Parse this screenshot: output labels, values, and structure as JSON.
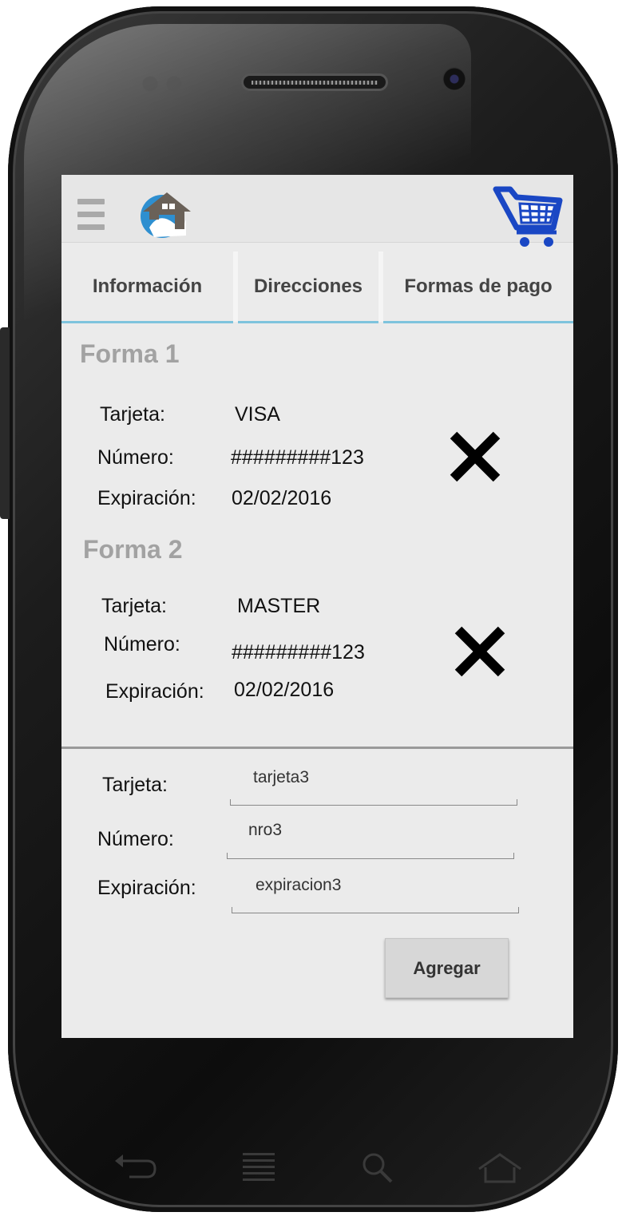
{
  "header": {
    "menu_icon": "hamburger-menu-icon",
    "logo_icon": "house-water-logo",
    "cart_icon": "shopping-cart-icon",
    "cart_color": "#1a47c4"
  },
  "tabs": [
    {
      "label": "Información"
    },
    {
      "label": "Direcciones"
    },
    {
      "label": "Formas de pago"
    }
  ],
  "payment_methods": [
    {
      "title": "Forma 1",
      "card_label": "Tarjeta:",
      "card_value": "VISA",
      "number_label": "Número:",
      "number_value": "#########123",
      "expiry_label": "Expiración:",
      "expiry_value": "02/02/2016",
      "delete_icon": "close-x-icon"
    },
    {
      "title": "Forma 2",
      "card_label": "Tarjeta:",
      "card_value": "MASTER",
      "number_label": "Número:",
      "number_value": "#########123",
      "expiry_label": "Expiración:",
      "expiry_value": "02/02/2016",
      "delete_icon": "close-x-icon"
    }
  ],
  "new_method_form": {
    "card_label": "Tarjeta:",
    "card_value": "tarjeta3",
    "number_label": "Número:",
    "number_value": "nro3",
    "expiry_label": "Expiración:",
    "expiry_value": "expiracion3",
    "submit_label": "Agregar"
  },
  "theme": {
    "tab_underline": "#7ec3dd",
    "section_title_color": "#a2a2a2",
    "screen_bg": "#ebebeb"
  }
}
